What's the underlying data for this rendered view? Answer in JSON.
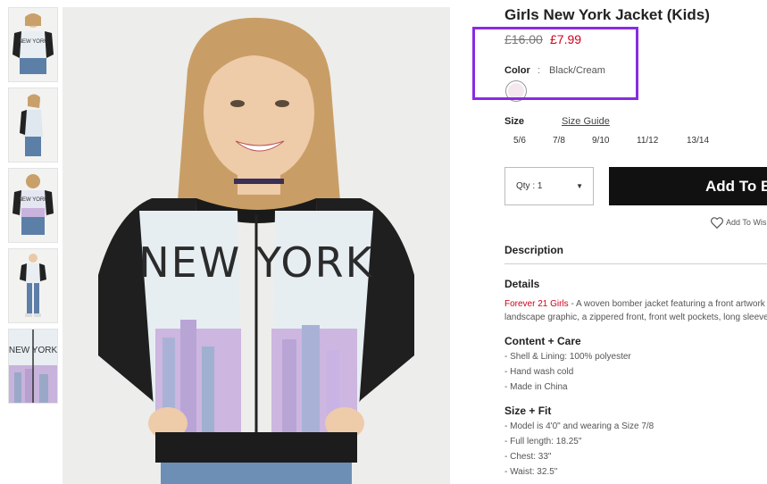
{
  "product": {
    "title": "Girls New York Jacket (Kids)",
    "price_old": "£16.00",
    "price_new": "£7.99",
    "color_label": "Color",
    "color_separator": ":",
    "color_value": "Black/Cream",
    "swatch_color": "#f4e8ee"
  },
  "size": {
    "label": "Size",
    "guide_label": "Size Guide",
    "options": [
      "5/6",
      "7/8",
      "9/10",
      "11/12",
      "13/14"
    ]
  },
  "purchase": {
    "qty_label": "Qty : 1",
    "add_label": "Add To Bag",
    "wishlist_label": "Add To Wishlist"
  },
  "description": {
    "heading": "Description",
    "details_heading": "Details",
    "brand": "Forever 21 Girls",
    "details_line1": " - A woven bomber jacket featuring a front artwork",
    "details_line2": "landscape graphic, a zippered front, front welt pockets, long sleeves",
    "content_heading": "Content + Care",
    "content_items": [
      "- Shell & Lining: 100% polyester",
      "- Hand wash cold",
      "- Made in China"
    ],
    "fit_heading": "Size + Fit",
    "fit_items": [
      "- Model is 4'0\" and wearing a Size 7/8",
      "- Full length: 18.25\"",
      "- Chest: 33\"",
      "- Waist: 32.5\""
    ]
  },
  "colors": {
    "sale_red": "#d0021b",
    "highlight": "#8a2be2",
    "button_black": "#111111"
  },
  "graphic_text": "NEW YORK"
}
